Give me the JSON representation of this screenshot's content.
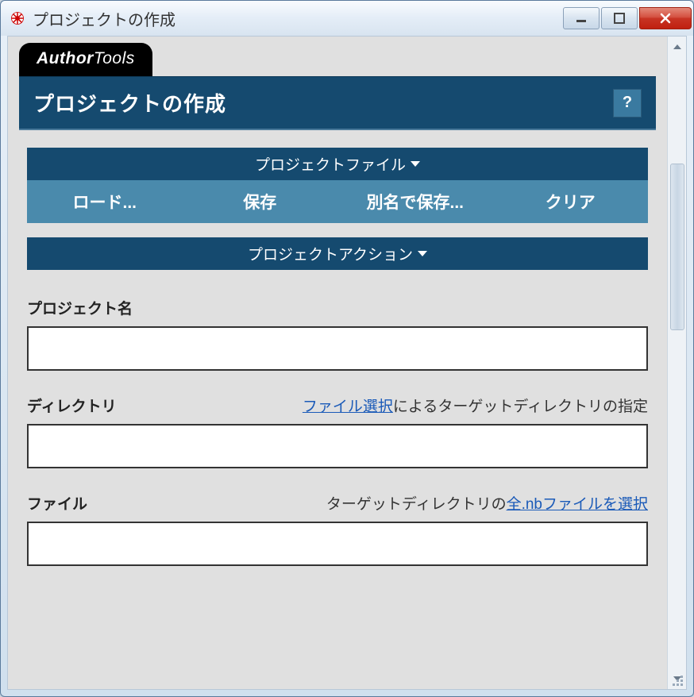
{
  "window": {
    "title": "プロジェクトの作成"
  },
  "brand": {
    "prefix": "Author",
    "suffix": "Tools"
  },
  "header": {
    "title": "プロジェクトの作成",
    "help": "?"
  },
  "dropdowns": {
    "project_file": "プロジェクトファイル",
    "project_action": "プロジェクトアクション"
  },
  "toolbar": {
    "load": "ロード...",
    "save": "保存",
    "save_as": "別名で保存...",
    "clear": "クリア"
  },
  "form": {
    "project_name": {
      "label": "プロジェクト名",
      "value": ""
    },
    "directory": {
      "label": "ディレクトリ",
      "link": "ファイル選択",
      "hint_suffix": "によるターゲットディレクトリの指定",
      "value": ""
    },
    "files": {
      "label": "ファイル",
      "hint_prefix": "ターゲットディレクトリの",
      "link": "全.nbファイルを選択",
      "value": ""
    }
  }
}
